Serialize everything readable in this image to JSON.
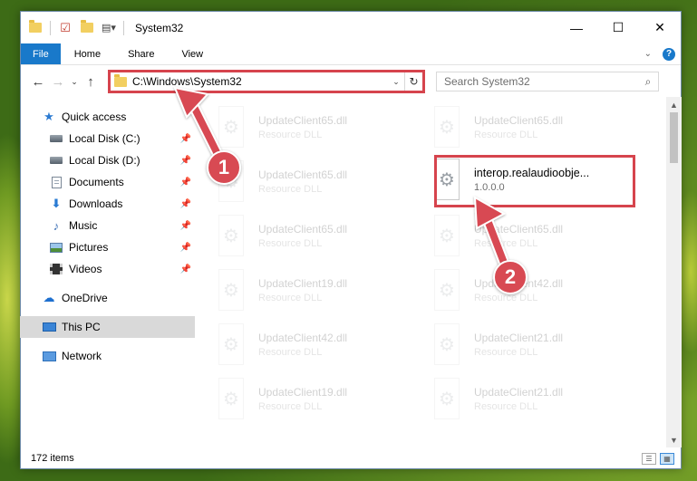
{
  "window": {
    "title": "System32",
    "controls": {
      "minimize": "—",
      "maximize": "☐",
      "close": "✕"
    }
  },
  "ribbon": {
    "tabs": [
      "File",
      "Home",
      "Share",
      "View"
    ],
    "help": "?"
  },
  "address_bar": {
    "path": "C:\\Windows\\System32"
  },
  "search": {
    "placeholder": "Search System32"
  },
  "nav_pane": {
    "quick_access": "Quick access",
    "pinned": [
      "Local Disk (C:)",
      "Local Disk (D:)",
      "Documents",
      "Downloads",
      "Music",
      "Pictures",
      "Videos"
    ],
    "onedrive": "OneDrive",
    "this_pc": "This PC",
    "network": "Network"
  },
  "files": [
    {
      "name": "UpdateClient65.dll",
      "type": "Resource DLL",
      "state": "faded"
    },
    {
      "name": "UpdateClient65.dll",
      "type": "Resource DLL",
      "state": "faded"
    },
    {
      "name": "UpdateClient65.dll",
      "type": "Resource DLL",
      "state": "faded"
    },
    {
      "name": "interop.realaudioobje...",
      "type": "1.0.0.0",
      "state": "highlighted"
    },
    {
      "name": "UpdateClient65.dll",
      "type": "Resource DLL",
      "state": "faded"
    },
    {
      "name": "UpdateClient65.dll",
      "type": "Resource DLL",
      "state": "faded"
    },
    {
      "name": "UpdateClient19.dll",
      "type": "Resource DLL",
      "state": "faded"
    },
    {
      "name": "UpdateClient42.dll",
      "type": "Resource DLL",
      "state": "faded"
    },
    {
      "name": "UpdateClient42.dll",
      "type": "Resource DLL",
      "state": "faded"
    },
    {
      "name": "UpdateClient21.dll",
      "type": "Resource DLL",
      "state": "faded"
    },
    {
      "name": "UpdateClient19.dll",
      "type": "Resource DLL",
      "state": "faded"
    },
    {
      "name": "UpdateClient21.dll",
      "type": "Resource DLL",
      "state": "faded"
    }
  ],
  "status_bar": {
    "item_count": "172 items"
  },
  "annotations": {
    "badge_1": "1",
    "badge_2": "2",
    "color": "#d84a53"
  }
}
